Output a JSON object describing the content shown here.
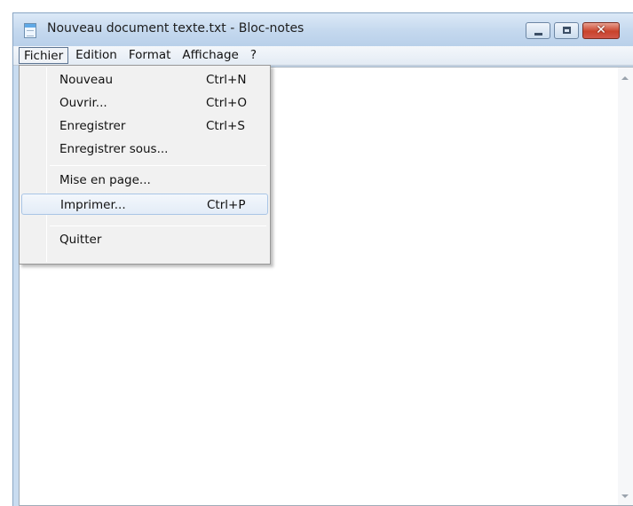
{
  "window": {
    "title": "Nouveau document texte.txt - Bloc-notes",
    "app_icon": "notepad-icon",
    "controls": [
      "minimize-icon",
      "maximize-icon",
      "close-icon"
    ],
    "close_symbol": "✕"
  },
  "menubar": {
    "items": [
      {
        "label": "Fichier",
        "active": true
      },
      {
        "label": "Edition"
      },
      {
        "label": "Format"
      },
      {
        "label": "Affichage"
      },
      {
        "label": "?"
      }
    ]
  },
  "file_menu": {
    "items": [
      {
        "label": "Nouveau",
        "shortcut": "Ctrl+N"
      },
      {
        "label": "Ouvrir...",
        "shortcut": "Ctrl+O"
      },
      {
        "label": "Enregistrer",
        "shortcut": "Ctrl+S"
      },
      {
        "label": "Enregistrer sous..."
      },
      {
        "label": "Mise en page..."
      },
      {
        "label": "Imprimer...",
        "shortcut": "Ctrl+P",
        "highlighted": true
      },
      {
        "label": "Quitter"
      }
    ]
  },
  "editor": {
    "content": ""
  },
  "colors": {
    "title_bar": "#c4d8ee",
    "close_button": "#c9432c",
    "menu_highlight": "#e3ecf7"
  }
}
